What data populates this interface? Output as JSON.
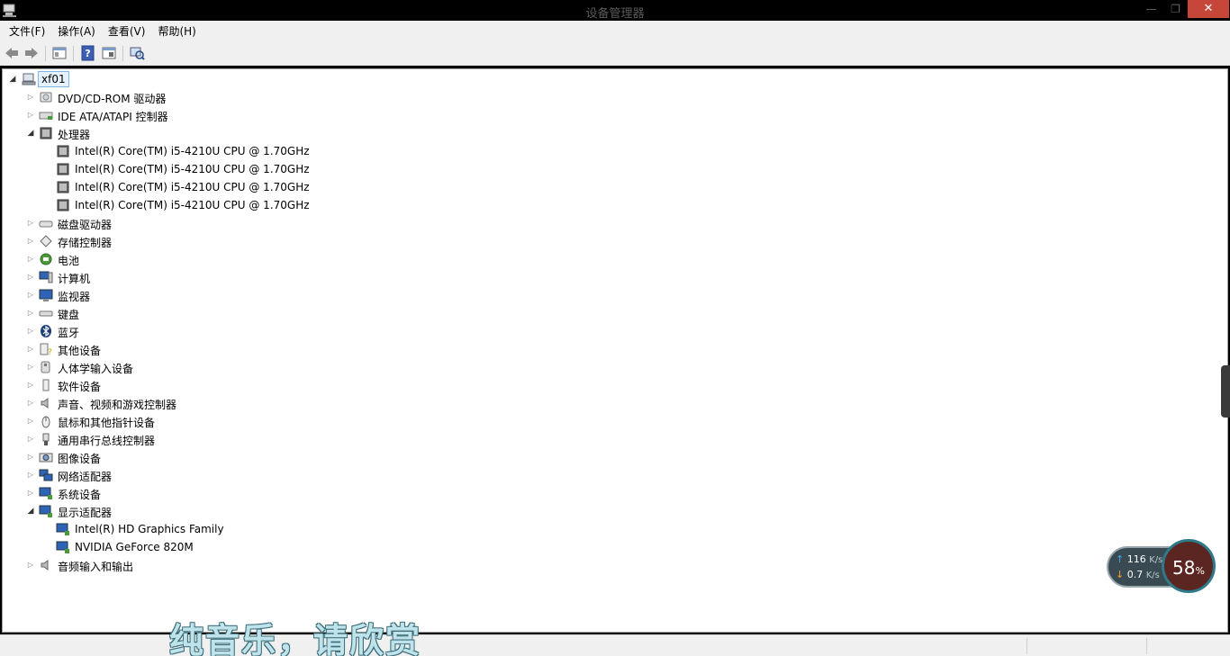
{
  "window": {
    "title": "设备管理器",
    "min": "—",
    "max": "❐",
    "close": "✕"
  },
  "menu": [
    "文件(F)",
    "操作(A)",
    "查看(V)",
    "帮助(H)"
  ],
  "tree": {
    "root": "xf01",
    "nodes": [
      {
        "label": "DVD/CD-ROM 驱动器",
        "expanded": false,
        "icon": "dvd-drive-icon"
      },
      {
        "label": "IDE ATA/ATAPI 控制器",
        "expanded": false,
        "icon": "ide-controller-icon"
      },
      {
        "label": "处理器",
        "expanded": true,
        "icon": "processor-icon",
        "children": [
          {
            "label": "Intel(R) Core(TM) i5-4210U CPU @ 1.70GHz",
            "icon": "processor-icon"
          },
          {
            "label": "Intel(R) Core(TM) i5-4210U CPU @ 1.70GHz",
            "icon": "processor-icon"
          },
          {
            "label": "Intel(R) Core(TM) i5-4210U CPU @ 1.70GHz",
            "icon": "processor-icon"
          },
          {
            "label": "Intel(R) Core(TM) i5-4210U CPU @ 1.70GHz",
            "icon": "processor-icon"
          }
        ]
      },
      {
        "label": "磁盘驱动器",
        "expanded": false,
        "icon": "disk-drive-icon"
      },
      {
        "label": "存储控制器",
        "expanded": false,
        "icon": "storage-controller-icon"
      },
      {
        "label": "电池",
        "expanded": false,
        "icon": "battery-icon"
      },
      {
        "label": "计算机",
        "expanded": false,
        "icon": "computer-icon"
      },
      {
        "label": "监视器",
        "expanded": false,
        "icon": "monitor-icon"
      },
      {
        "label": "键盘",
        "expanded": false,
        "icon": "keyboard-icon"
      },
      {
        "label": "蓝牙",
        "expanded": false,
        "icon": "bluetooth-icon"
      },
      {
        "label": "其他设备",
        "expanded": false,
        "icon": "other-devices-icon"
      },
      {
        "label": "人体学输入设备",
        "expanded": false,
        "icon": "hid-icon"
      },
      {
        "label": "软件设备",
        "expanded": false,
        "icon": "software-device-icon"
      },
      {
        "label": "声音、视频和游戏控制器",
        "expanded": false,
        "icon": "sound-icon"
      },
      {
        "label": "鼠标和其他指针设备",
        "expanded": false,
        "icon": "mouse-icon"
      },
      {
        "label": "通用串行总线控制器",
        "expanded": false,
        "icon": "usb-icon"
      },
      {
        "label": "图像设备",
        "expanded": false,
        "icon": "camera-icon"
      },
      {
        "label": "网络适配器",
        "expanded": false,
        "icon": "network-adapter-icon"
      },
      {
        "label": "系统设备",
        "expanded": false,
        "icon": "system-device-icon"
      },
      {
        "label": "显示适配器",
        "expanded": true,
        "icon": "display-adapter-icon",
        "children": [
          {
            "label": "Intel(R) HD Graphics Family",
            "icon": "display-adapter-icon"
          },
          {
            "label": "NVIDIA GeForce 820M",
            "icon": "display-adapter-icon"
          }
        ]
      },
      {
        "label": "音频输入和输出",
        "expanded": false,
        "icon": "audio-io-icon"
      }
    ]
  },
  "overlay": {
    "subtitle": "纯音乐，请欣赏",
    "net_up": "116",
    "net_down": "0.7",
    "net_unit": "K/s",
    "cpu_percent": "58",
    "percent_sign": "%",
    "up_arrow": "↑",
    "down_arrow": "↓"
  },
  "colors": {
    "accent": "#c7463a",
    "selection": "#e5f1fb",
    "gauge": "#5b2622"
  }
}
